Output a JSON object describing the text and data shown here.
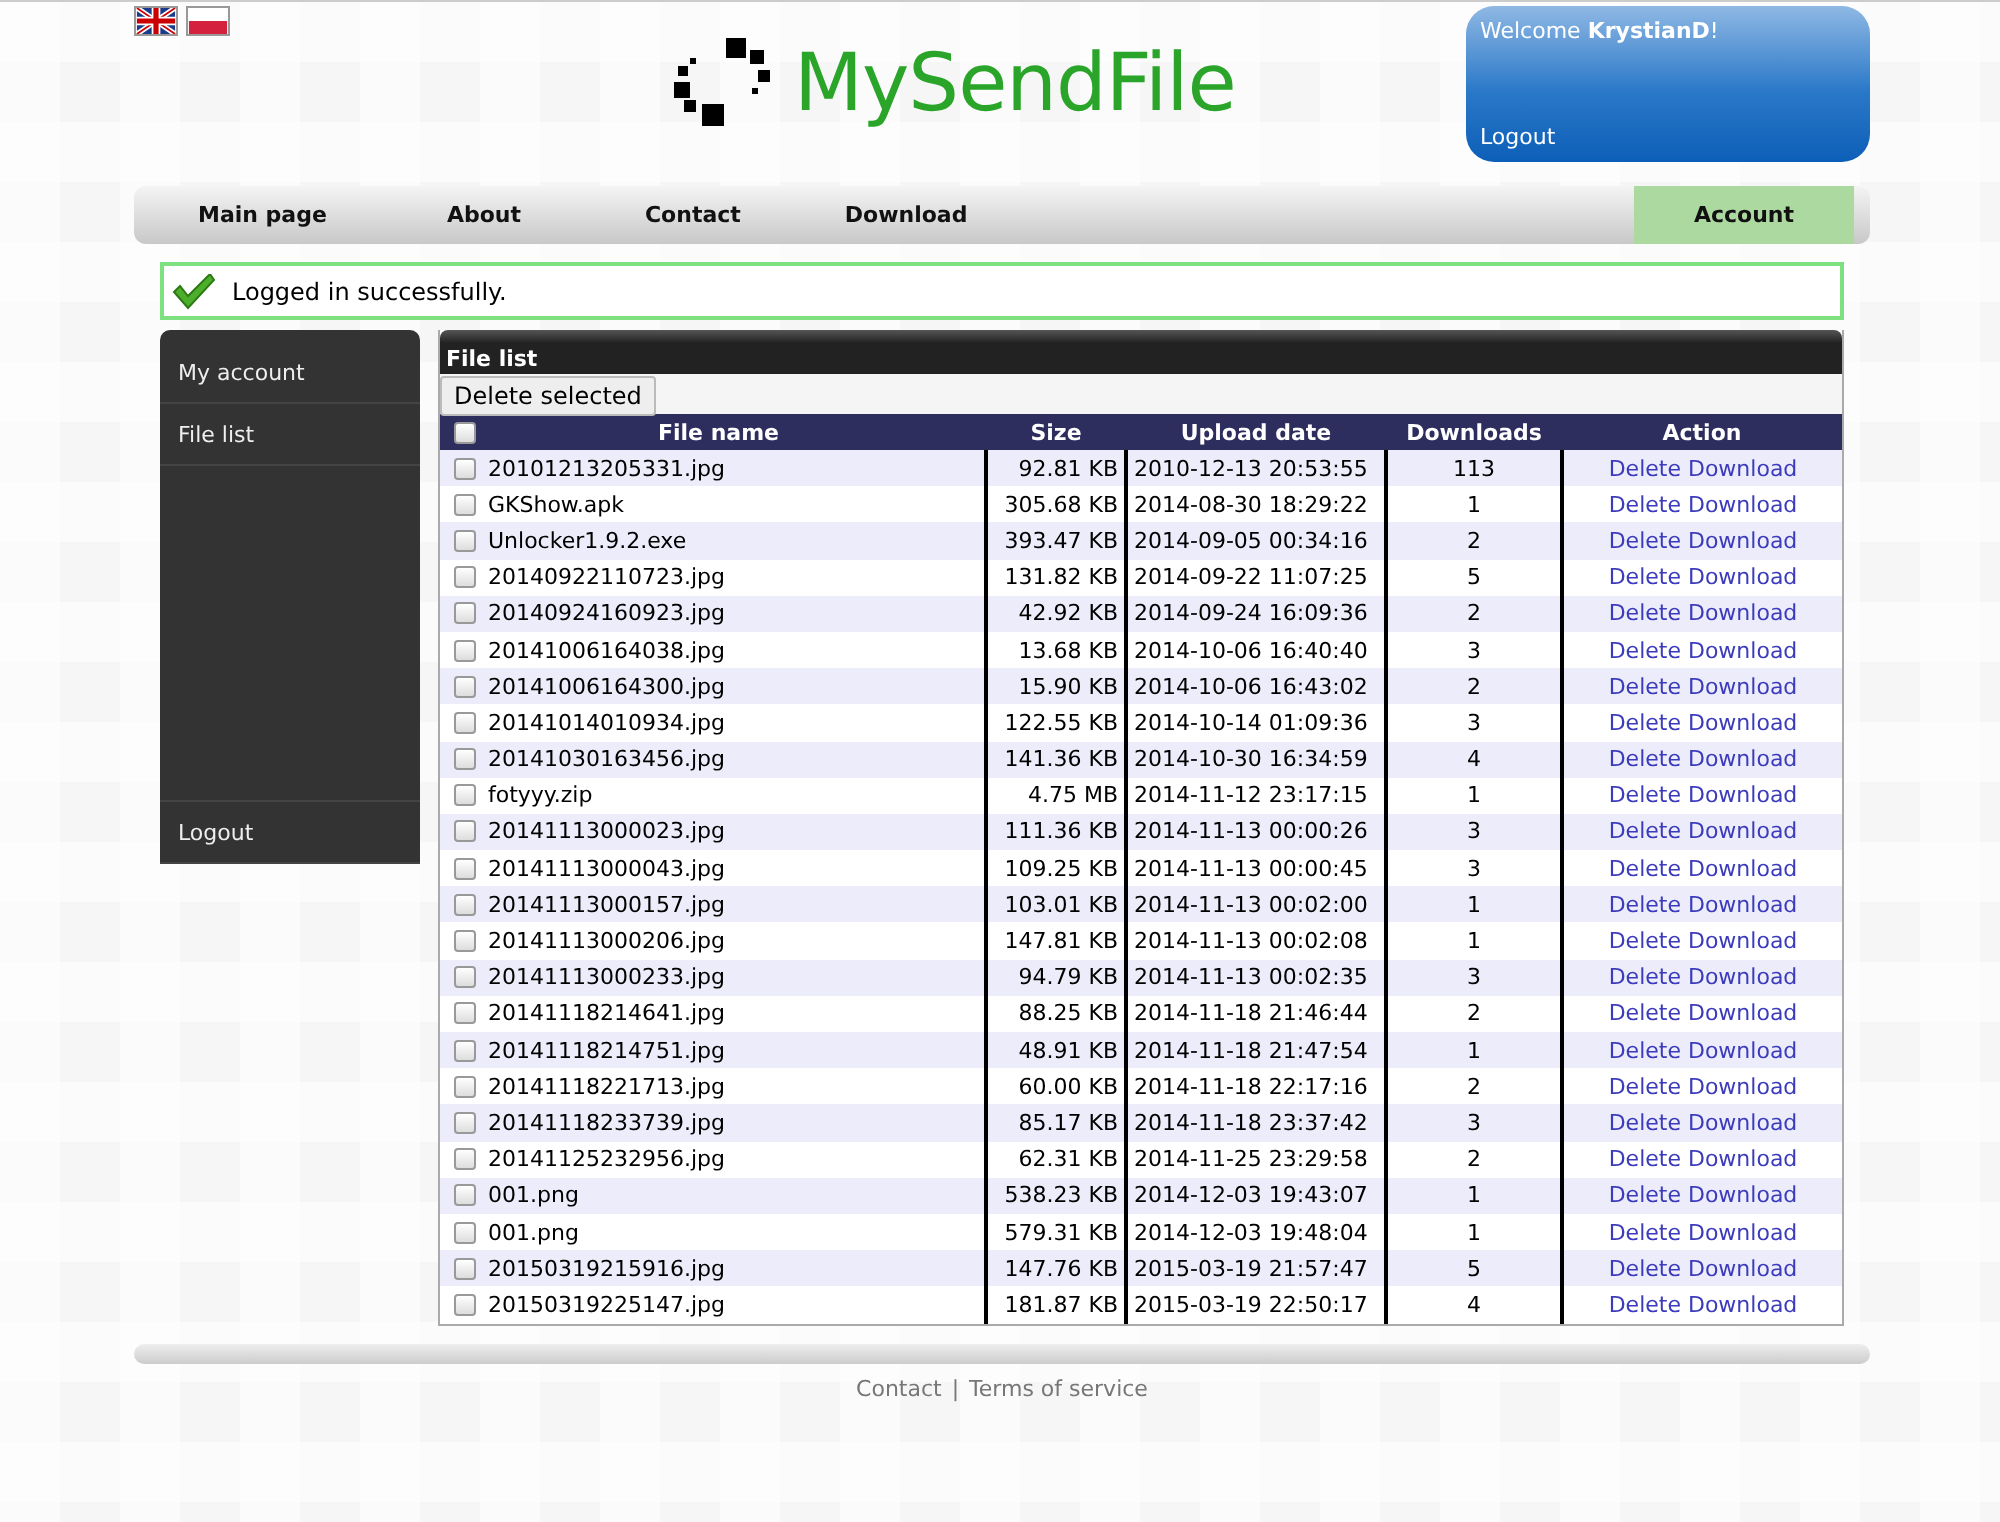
{
  "logo": {
    "text": "MySendFile"
  },
  "user_box": {
    "welcome": "Welcome **KrystianD**!",
    "logout": "Logout"
  },
  "nav": [
    {
      "label": "Main page",
      "selected": false
    },
    {
      "label": "About",
      "selected": false
    },
    {
      "label": "Contact",
      "selected": false
    },
    {
      "label": "Download",
      "selected": false
    },
    {
      "label": "Account",
      "selected": true
    }
  ],
  "message": "Logged in successfully.",
  "sidebar": {
    "items": [
      "My account",
      "File list"
    ],
    "logout": "Logout"
  },
  "file_list": {
    "title": "File list",
    "delete_selected": "Delete selected",
    "select_all_checked": false,
    "columns": [
      "File name",
      "Size",
      "Upload date",
      "Downloads",
      "Action"
    ],
    "rows": [
      {
        "name": "20101213205331.jpg",
        "size": "92.81 KB",
        "date": "2010-12-13 20:53:55",
        "downloads": "113",
        "actions": [
          "Delete",
          "Download"
        ],
        "checked": false
      },
      {
        "name": "GKShow.apk",
        "size": "305.68 KB",
        "date": "2014-08-30 18:29:22",
        "downloads": "1",
        "actions": [
          "Delete",
          "Download"
        ],
        "checked": false
      },
      {
        "name": "Unlocker1.9.2.exe",
        "size": "393.47 KB",
        "date": "2014-09-05 00:34:16",
        "downloads": "2",
        "actions": [
          "Delete",
          "Download"
        ],
        "checked": false
      },
      {
        "name": "20140922110723.jpg",
        "size": "131.82 KB",
        "date": "2014-09-22 11:07:25",
        "downloads": "5",
        "actions": [
          "Delete",
          "Download"
        ],
        "checked": false
      },
      {
        "name": "20140924160923.jpg",
        "size": "42.92 KB",
        "date": "2014-09-24 16:09:36",
        "downloads": "2",
        "actions": [
          "Delete",
          "Download"
        ],
        "checked": false
      },
      {
        "name": "20141006164038.jpg",
        "size": "13.68 KB",
        "date": "2014-10-06 16:40:40",
        "downloads": "3",
        "actions": [
          "Delete",
          "Download"
        ],
        "checked": false
      },
      {
        "name": "20141006164300.jpg",
        "size": "15.90 KB",
        "date": "2014-10-06 16:43:02",
        "downloads": "2",
        "actions": [
          "Delete",
          "Download"
        ],
        "checked": false
      },
      {
        "name": "20141014010934.jpg",
        "size": "122.55 KB",
        "date": "2014-10-14 01:09:36",
        "downloads": "3",
        "actions": [
          "Delete",
          "Download"
        ],
        "checked": false
      },
      {
        "name": "20141030163456.jpg",
        "size": "141.36 KB",
        "date": "2014-10-30 16:34:59",
        "downloads": "4",
        "actions": [
          "Delete",
          "Download"
        ],
        "checked": false
      },
      {
        "name": "fotyyy.zip",
        "size": "4.75 MB",
        "date": "2014-11-12 23:17:15",
        "downloads": "1",
        "actions": [
          "Delete",
          "Download"
        ],
        "checked": false
      },
      {
        "name": "20141113000023.jpg",
        "size": "111.36 KB",
        "date": "2014-11-13 00:00:26",
        "downloads": "3",
        "actions": [
          "Delete",
          "Download"
        ],
        "checked": false
      },
      {
        "name": "20141113000043.jpg",
        "size": "109.25 KB",
        "date": "2014-11-13 00:00:45",
        "downloads": "3",
        "actions": [
          "Delete",
          "Download"
        ],
        "checked": false
      },
      {
        "name": "20141113000157.jpg",
        "size": "103.01 KB",
        "date": "2014-11-13 00:02:00",
        "downloads": "1",
        "actions": [
          "Delete",
          "Download"
        ],
        "checked": false
      },
      {
        "name": "20141113000206.jpg",
        "size": "147.81 KB",
        "date": "2014-11-13 00:02:08",
        "downloads": "1",
        "actions": [
          "Delete",
          "Download"
        ],
        "checked": false
      },
      {
        "name": "20141113000233.jpg",
        "size": "94.79 KB",
        "date": "2014-11-13 00:02:35",
        "downloads": "3",
        "actions": [
          "Delete",
          "Download"
        ],
        "checked": false
      },
      {
        "name": "20141118214641.jpg",
        "size": "88.25 KB",
        "date": "2014-11-18 21:46:44",
        "downloads": "2",
        "actions": [
          "Delete",
          "Download"
        ],
        "checked": false
      },
      {
        "name": "20141118214751.jpg",
        "size": "48.91 KB",
        "date": "2014-11-18 21:47:54",
        "downloads": "1",
        "actions": [
          "Delete",
          "Download"
        ],
        "checked": false
      },
      {
        "name": "20141118221713.jpg",
        "size": "60.00 KB",
        "date": "2014-11-18 22:17:16",
        "downloads": "2",
        "actions": [
          "Delete",
          "Download"
        ],
        "checked": false
      },
      {
        "name": "20141118233739.jpg",
        "size": "85.17 KB",
        "date": "2014-11-18 23:37:42",
        "downloads": "3",
        "actions": [
          "Delete",
          "Download"
        ],
        "checked": false
      },
      {
        "name": "20141125232956.jpg",
        "size": "62.31 KB",
        "date": "2014-11-25 23:29:58",
        "downloads": "2",
        "actions": [
          "Delete",
          "Download"
        ],
        "checked": false
      },
      {
        "name": "001.png",
        "size": "538.23 KB",
        "date": "2014-12-03 19:43:07",
        "downloads": "1",
        "actions": [
          "Delete",
          "Download"
        ],
        "checked": false
      },
      {
        "name": "001.png",
        "size": "579.31 KB",
        "date": "2014-12-03 19:48:04",
        "downloads": "1",
        "actions": [
          "Delete",
          "Download"
        ],
        "checked": false
      },
      {
        "name": "20150319215916.jpg",
        "size": "147.76 KB",
        "date": "2015-03-19 21:57:47",
        "downloads": "5",
        "actions": [
          "Delete",
          "Download"
        ],
        "checked": false
      },
      {
        "name": "20150319225147.jpg",
        "size": "181.87 KB",
        "date": "2015-03-19 22:50:17",
        "downloads": "4",
        "actions": [
          "Delete",
          "Download"
        ],
        "checked": false
      }
    ]
  },
  "footer": {
    "links": [
      "Contact",
      "Terms of service"
    ],
    "separator": "|"
  }
}
